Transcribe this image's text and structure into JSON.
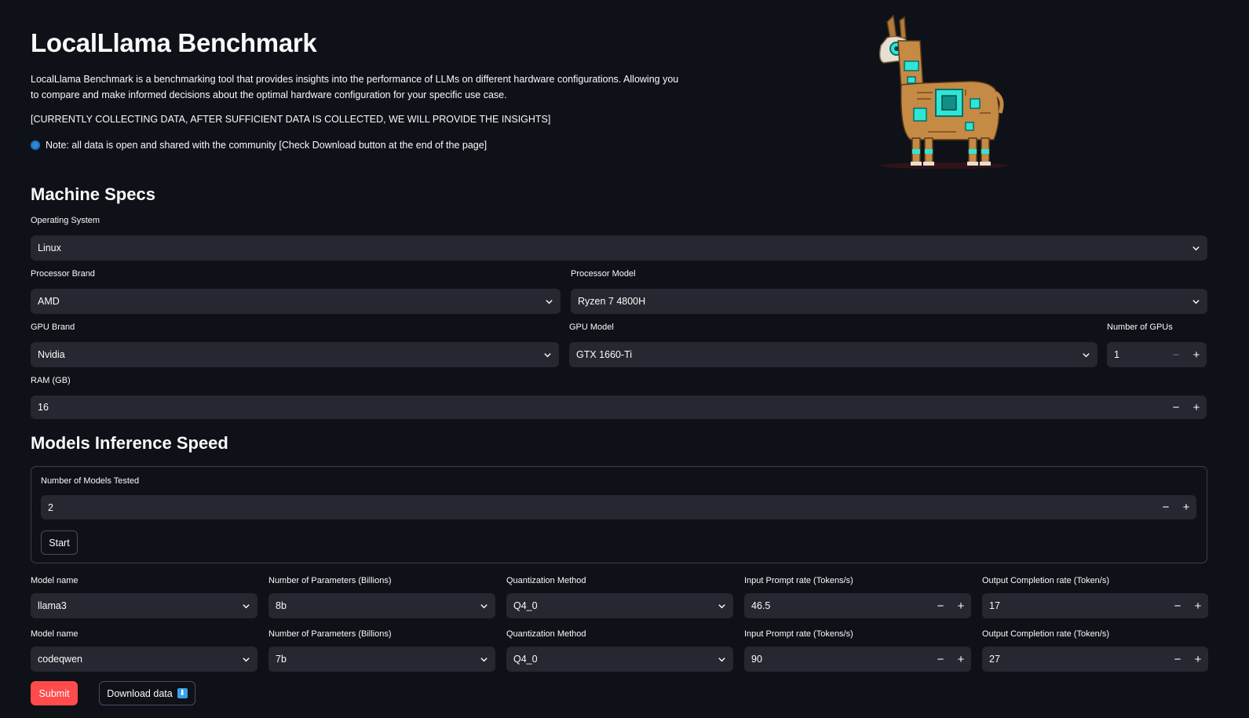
{
  "header": {
    "title": "LocalLlama Benchmark",
    "intro": "LocalLlama Benchmark is a benchmarking tool that provides insights into the performance of LLMs on different hardware configurations. Allowing you to compare and make informed decisions about the optimal hardware configuration for your specific use case.",
    "collecting": "[CURRENTLY COLLECTING DATA, AFTER SUFFICIENT DATA IS COLLECTED, WE WILL PROVIDE THE INSIGHTS]",
    "note": "Note: all data is open and shared with the community [Check Download button at the end of the page]"
  },
  "machine": {
    "heading": "Machine Specs",
    "os": {
      "label": "Operating System",
      "value": "Linux"
    },
    "proc_brand": {
      "label": "Processor Brand",
      "value": "AMD"
    },
    "proc_model": {
      "label": "Processor Model",
      "value": "Ryzen 7 4800H"
    },
    "gpu_brand": {
      "label": "GPU Brand",
      "value": "Nvidia"
    },
    "gpu_model": {
      "label": "GPU Model",
      "value": "GTX 1660-Ti"
    },
    "num_gpus": {
      "label": "Number of GPUs",
      "value": "1"
    },
    "ram": {
      "label": "RAM (GB)",
      "value": "16"
    }
  },
  "models": {
    "heading": "Models Inference Speed",
    "count": {
      "label": "Number of Models Tested",
      "value": "2"
    },
    "start_label": "Start",
    "rows": [
      {
        "name_label": "Model name",
        "name": "llama3",
        "params_label": "Number of Parameters (Billions)",
        "params": "8b",
        "quant_label": "Quantization Method",
        "quant": "Q4_0",
        "input_label": "Input Prompt rate (Tokens/s)",
        "input": "46.5",
        "output_label": "Output Completion rate (Token/s)",
        "output": "17"
      },
      {
        "name_label": "Model name",
        "name": "codeqwen",
        "params_label": "Number of Parameters (Billions)",
        "params": "7b",
        "quant_label": "Quantization Method",
        "quant": "Q4_0",
        "input_label": "Input Prompt rate (Tokens/s)",
        "input": "90",
        "output_label": "Output Completion rate (Token/s)",
        "output": "27"
      }
    ]
  },
  "actions": {
    "submit_label": "Submit",
    "download_label": "Download data",
    "download_icon": "down-arrow-icon"
  },
  "colors": {
    "background": "#0e1117",
    "input_bg": "#262730",
    "primary": "#ff4b4b",
    "note_dot": "#2e86de"
  }
}
